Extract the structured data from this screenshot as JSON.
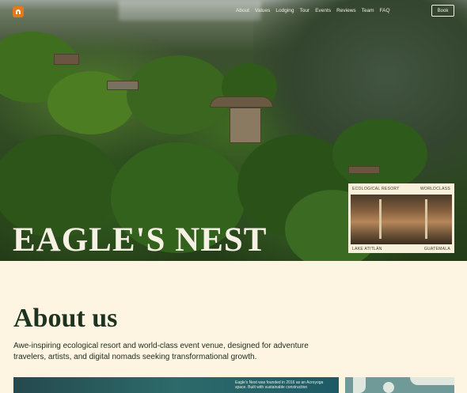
{
  "brand": {
    "logo_icon": "mountain-arch-icon",
    "accent": "#e07a1c"
  },
  "nav": {
    "items": [
      "About",
      "Values",
      "Lodging",
      "Tour",
      "Events",
      "Reviews",
      "Team",
      "FAQ"
    ],
    "book_label": "Book"
  },
  "hero": {
    "title": "EAGLE'S NEST"
  },
  "card": {
    "top_left": "ECOLOGICAL RESORT",
    "top_right": "WORLDCLASS",
    "bottom_left": "LAKE ATITLÁN",
    "bottom_right": "GUATEMALA"
  },
  "about": {
    "title": "About us",
    "description": "Awe-inspiring ecological resort and world-class event venue, designed for adventure travelers, artists, and digital nomads seeking transformational growth.",
    "strip_text": "Eagle's Nest was founded in 2016 as an Acroyoga space. Built with sustainable construction"
  }
}
